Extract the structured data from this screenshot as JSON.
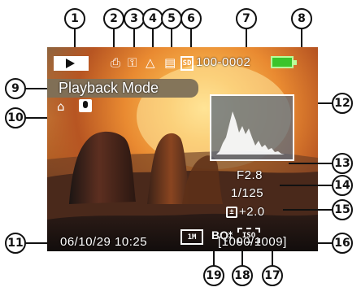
{
  "screen": {
    "mode_label": "Playback Mode",
    "file_number": "100-0002",
    "datetime": "06/10/29 10:25",
    "aperture": "F2.8",
    "shutter": "1/125",
    "exposure": "+2.0",
    "image_count": "[1000/1009]",
    "size_code": "1M",
    "quality_code": "BQ",
    "iso_code": "ISO"
  },
  "callouts": [
    "1",
    "2",
    "3",
    "4",
    "5",
    "6",
    "7",
    "8",
    "9",
    "10",
    "11",
    "12",
    "13",
    "14",
    "15",
    "16",
    "17",
    "18",
    "19"
  ],
  "colors": {
    "battery": "#5fd34a",
    "text": "#ffffff",
    "mode_bar": "#7d7058"
  }
}
